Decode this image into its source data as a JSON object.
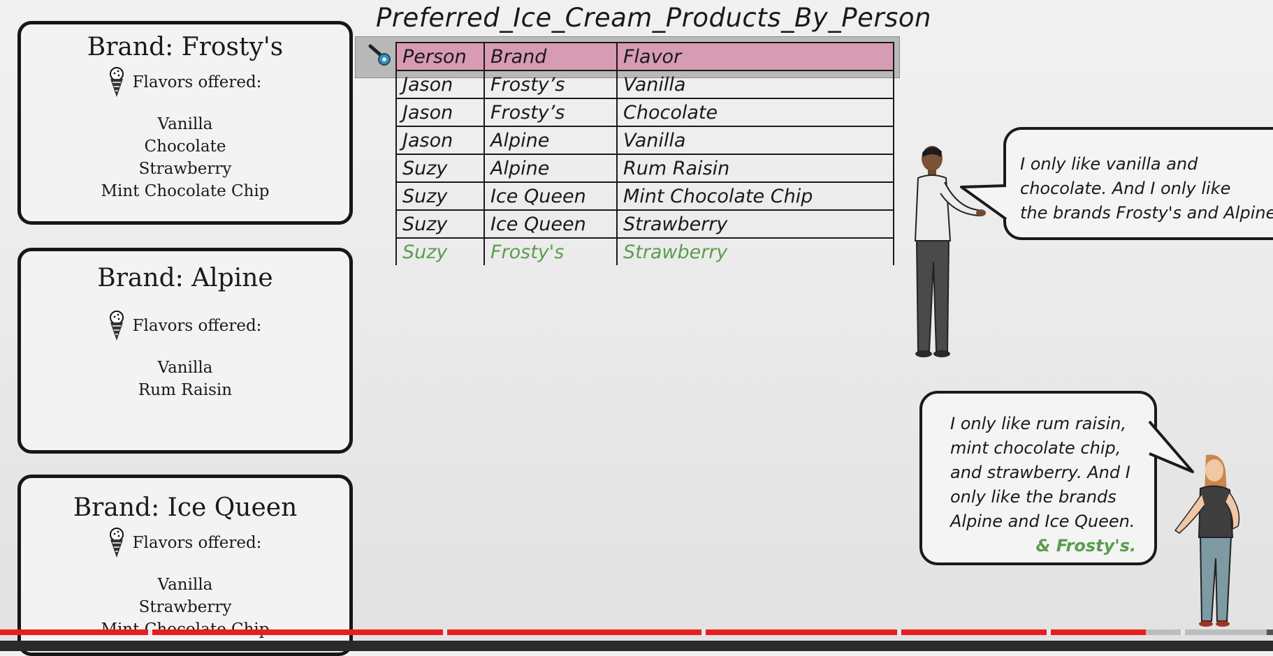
{
  "brands": [
    {
      "title": "Brand: Frosty's",
      "flavors_label": "Flavors offered:",
      "flavors": [
        "Vanilla",
        "Chocolate",
        "Strawberry",
        "Mint Chocolate Chip"
      ]
    },
    {
      "title": "Brand: Alpine",
      "flavors_label": "Flavors offered:",
      "flavors": [
        "Vanilla",
        "Rum Raisin"
      ]
    },
    {
      "title": "Brand: Ice Queen",
      "flavors_label": "Flavors offered:",
      "flavors": [
        "Vanilla",
        "Strawberry",
        "Mint Chocolate Chip"
      ]
    }
  ],
  "table": {
    "title": "Preferred_Ice_Cream_Products_By_Person",
    "headers": [
      "Person",
      "Brand",
      "Flavor"
    ],
    "rows": [
      [
        "Jason",
        "Frosty’s",
        "Vanilla"
      ],
      [
        "Jason",
        "Frosty’s",
        "Chocolate"
      ],
      [
        "Jason",
        "Alpine",
        "Vanilla"
      ],
      [
        "Suzy",
        "Alpine",
        "Rum Raisin"
      ],
      [
        "Suzy",
        "Ice Queen",
        "Mint Chocolate Chip"
      ],
      [
        "Suzy",
        "Ice Queen",
        "Strawberry"
      ],
      [
        "Suzy",
        "Frosty's",
        "Strawberry"
      ]
    ],
    "header_color": "#d79cb3",
    "added_row_color": "#5a9e4c"
  },
  "bubbles": {
    "jason": [
      "I only like vanilla and",
      "chocolate. And I only like",
      "the brands Frosty's and Alpine"
    ],
    "suzy": [
      "I only like rum raisin,",
      "mint chocolate chip,",
      "and strawberry. And I",
      "only like the brands",
      "Alpine and Ice Queen."
    ],
    "suzy_addition": "& Frosty's."
  },
  "icons": {
    "cone": "ice-cream-cone-icon",
    "key": "primary-key-icon"
  },
  "progress": {
    "played_fraction": 0.9,
    "buffered_fraction": 0.995,
    "color": "#e81e1e"
  }
}
